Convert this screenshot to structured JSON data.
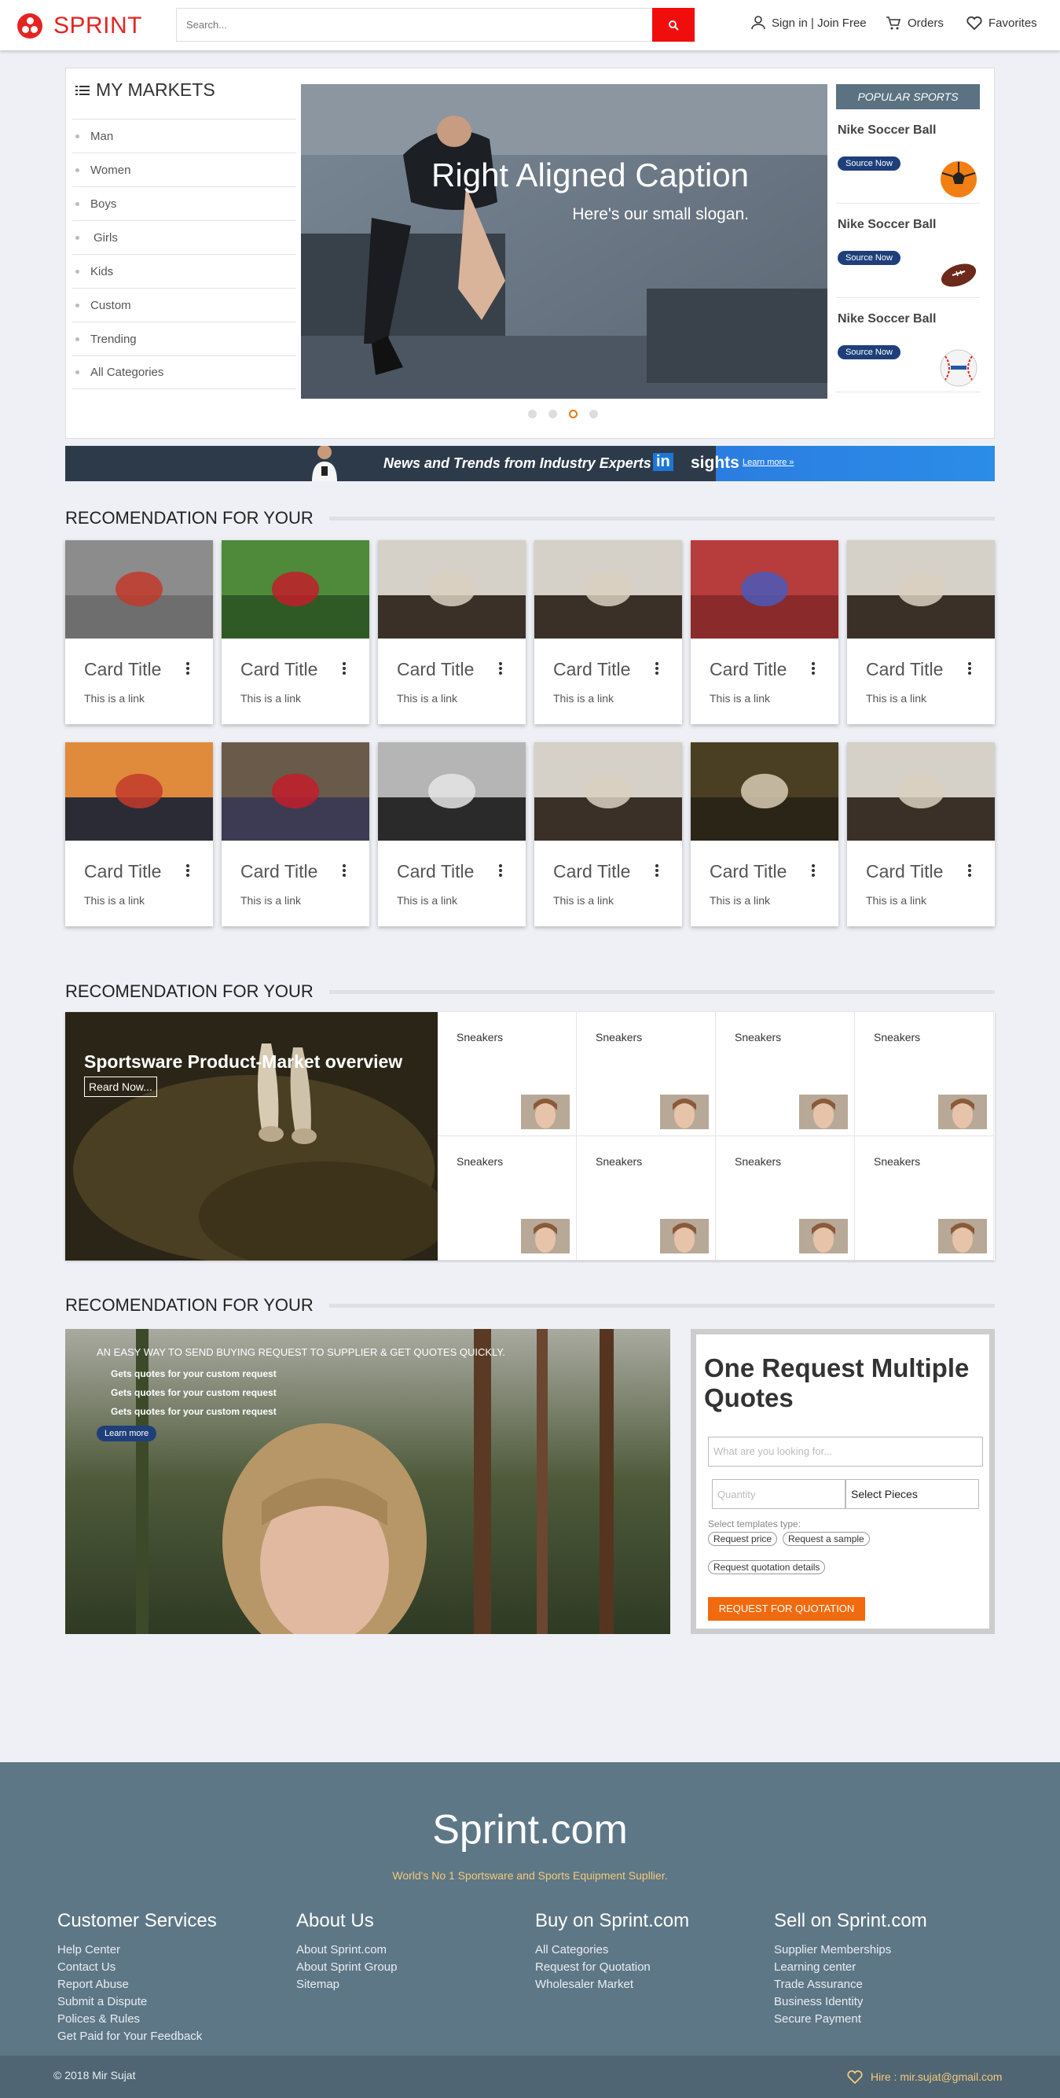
{
  "header": {
    "brand": "SPRINT",
    "search_placeholder": "Search...",
    "signin": "Sign in | Join Free",
    "orders": "Orders",
    "favorites": "Favorites",
    "accent_color": "#e52421"
  },
  "markets": {
    "title": "MY MARKETS",
    "items": [
      "Man",
      "Women",
      "Boys",
      "Girls",
      "Kids",
      "Custom",
      "Trending",
      "All Categories"
    ]
  },
  "slider": {
    "caption": "Right Aligned Caption",
    "slogan": "Here's our small slogan.",
    "active_slide": 3,
    "slide_count": 4
  },
  "popular": {
    "title": "POPULAR SPORTS",
    "items": [
      {
        "name": "Nike Soccer Ball",
        "button": "Source Now",
        "icon": "soccer-ball-icon"
      },
      {
        "name": "Nike Soccer Ball",
        "button": "Source Now",
        "icon": "football-icon"
      },
      {
        "name": "Nike Soccer Ball",
        "button": "Source Now",
        "icon": "baseball-icon"
      }
    ]
  },
  "insights_banner": {
    "text": "News and Trends from Industry Experts",
    "logo_in": "in",
    "logo_sights": "sights",
    "learn": "Learn more »"
  },
  "section1": {
    "title": "RECOMENDATION FOR YOUR",
    "cards": [
      {
        "title": "Card Title",
        "link": "This is a link"
      },
      {
        "title": "Card Title",
        "link": "This is a link"
      },
      {
        "title": "Card Title",
        "link": "This is a link"
      },
      {
        "title": "Card Title",
        "link": "This is a link"
      },
      {
        "title": "Card Title",
        "link": "This is a link"
      },
      {
        "title": "Card Title",
        "link": "This is a link"
      },
      {
        "title": "Card Title",
        "link": "This is a link"
      },
      {
        "title": "Card Title",
        "link": "This is a link"
      },
      {
        "title": "Card Title",
        "link": "This is a link"
      },
      {
        "title": "Card Title",
        "link": "This is a link"
      },
      {
        "title": "Card Title",
        "link": "This is a link"
      },
      {
        "title": "Card Title",
        "link": "This is a link"
      }
    ]
  },
  "section2": {
    "title": "RECOMENDATION FOR YOUR",
    "hero_title": "Sportsware Product-Market overview",
    "hero_button": "Reard Now...",
    "items": [
      "Sneakers",
      "Sneakers",
      "Sneakers",
      "Sneakers",
      "Sneakers",
      "Sneakers",
      "Sneakers",
      "Sneakers"
    ]
  },
  "section3": {
    "title": "RECOMENDATION FOR YOUR",
    "headline": "AN EASY WAY TO SEND BUYING REQUEST TO SUPPLIER & GET QUOTES QUICKLY.",
    "bullets": [
      "Gets quotes for your custom request",
      "Gets quotes for your custom request",
      "Gets quotes for your custom request"
    ],
    "learn": "Learn more"
  },
  "rfq": {
    "title": "One Request Multiple Quotes",
    "search_placeholder": "What are you looking for...",
    "quantity_placeholder": "Quantity",
    "pieces": "Select Pieces",
    "templates_label": "Select templates type:",
    "chips": [
      "Request price",
      "Request a sample",
      "Request quotation details"
    ],
    "submit": "REQUEST FOR QUOTATION",
    "submit_color": "#f26a0e"
  },
  "footer": {
    "brand": "Sprint.com",
    "tagline": "World's No 1 Sportsware and Sports Equipment Supllier.",
    "columns": [
      {
        "title": "Customer Services",
        "links": [
          "Help Center",
          "Contact Us",
          "Report Abuse",
          "Submit a Dispute",
          "Polices & Rules",
          "Get Paid for Your Feedback"
        ]
      },
      {
        "title": "About Us",
        "links": [
          "About Sprint.com",
          "About Sprint Group",
          "Sitemap"
        ]
      },
      {
        "title": "Buy on Sprint.com",
        "links": [
          "All Categories",
          "Request for Quotation",
          "Wholesaler Market"
        ]
      },
      {
        "title": "Sell on Sprint.com",
        "links": [
          "Supplier Memberships",
          "Learning center",
          "Trade Assurance",
          "Business Identity",
          "Secure Payment"
        ]
      }
    ],
    "copyright": "© 2018 Mir Sujat",
    "hire": "Hire : mir.sujat@gmail.com",
    "bg_color": "#5e7786"
  }
}
